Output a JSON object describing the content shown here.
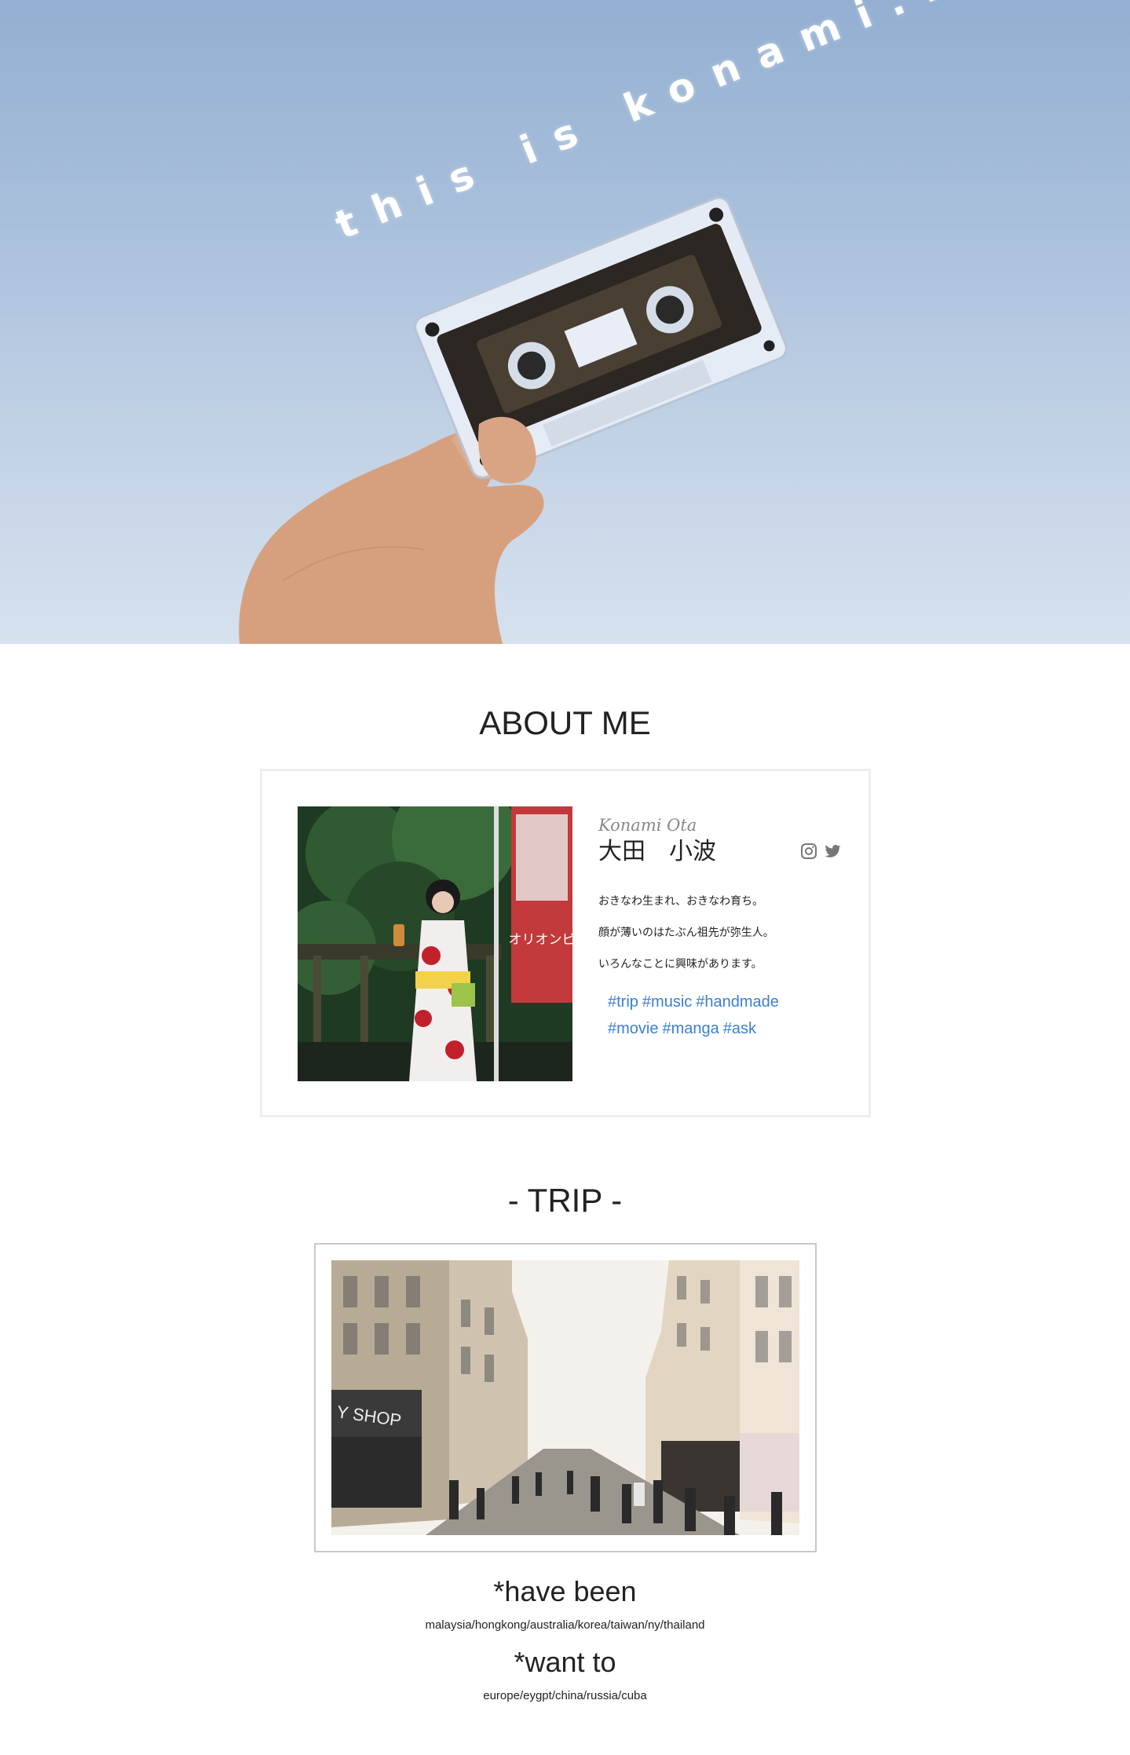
{
  "hero": {
    "tagline": "this is konami..."
  },
  "about": {
    "heading": "ABOUT ME",
    "name_script": "Konami Ota",
    "name_kanji": "大田　小波",
    "bio": [
      "おきなわ生まれ、おきなわ育ち。",
      "顔が薄いのはたぶん祖先が弥生人。",
      "いろんなことに興味があります。"
    ],
    "tags": [
      "#trip",
      "#music",
      "#handmade",
      "#movie",
      "#manga",
      "#ask"
    ],
    "banner_text": "オリオンビ",
    "social_icons": [
      "instagram-icon",
      "twitter-icon"
    ]
  },
  "trip": {
    "heading": "- TRIP -",
    "sign_text": "Y SHOP",
    "have_been_heading": "*have been",
    "have_been_list": "malaysia/hongkong/australia/korea/taiwan/ny/thailand",
    "want_to_heading": "*want to",
    "want_to_list": "europe/eygpt/china/russia/cuba"
  },
  "colors": {
    "tag_link": "#3b7fd1",
    "sky_top": "#93afd1",
    "sky_bottom": "#d6e1ee"
  }
}
